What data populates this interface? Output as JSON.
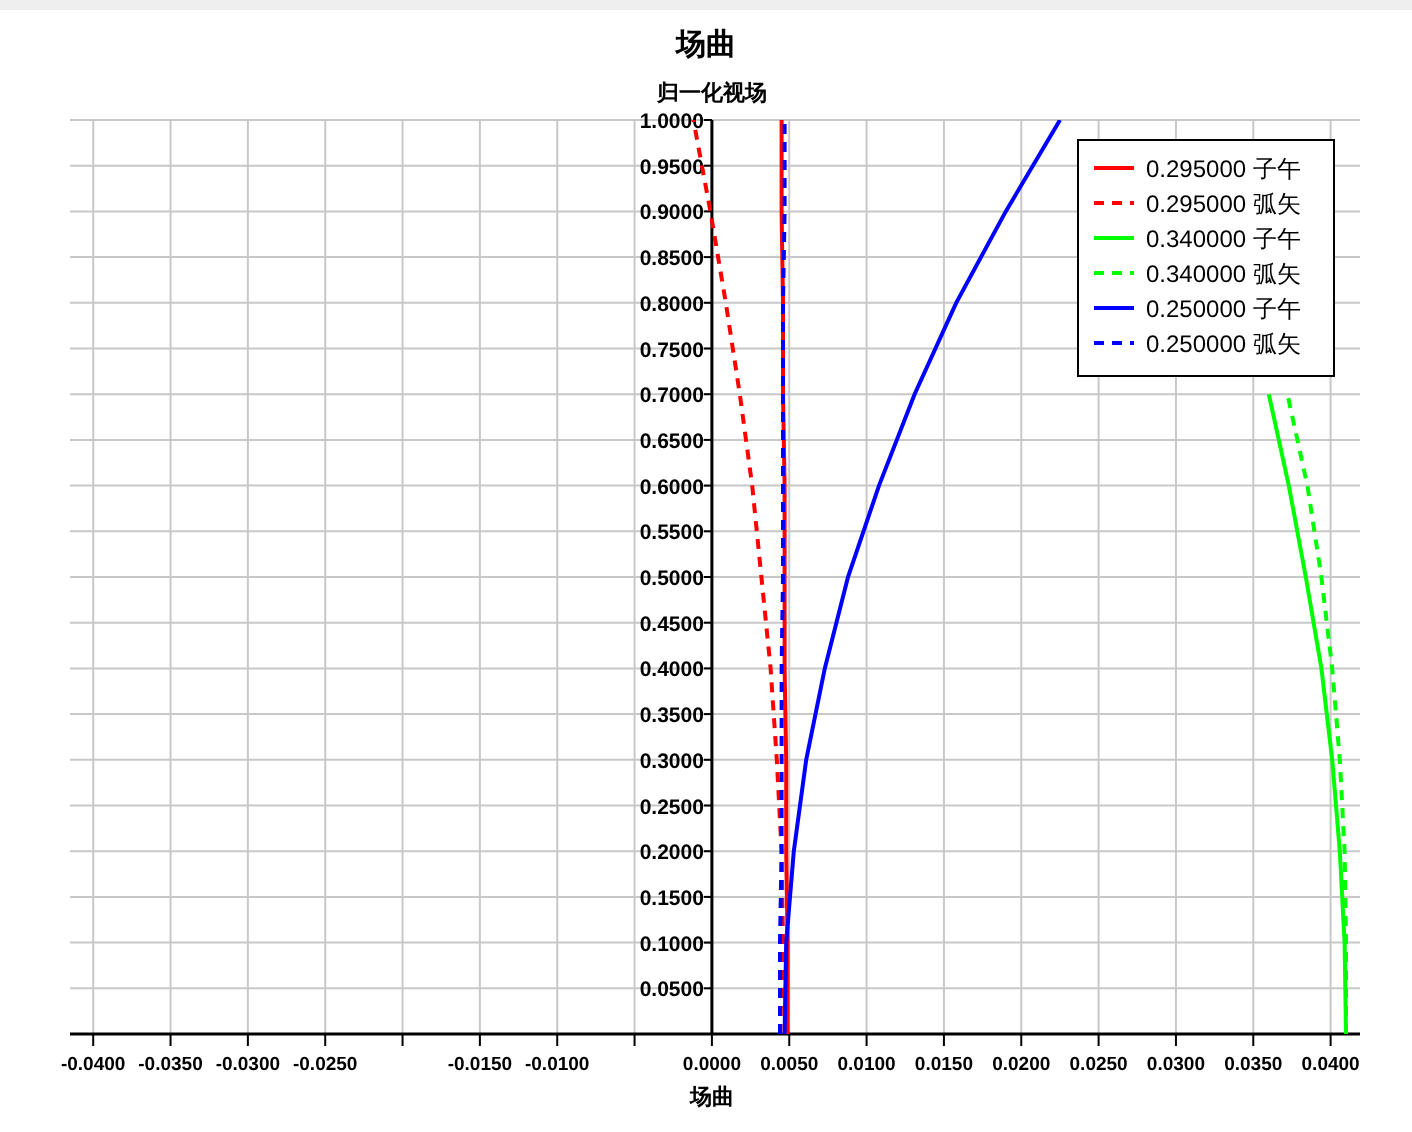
{
  "chart_data": {
    "type": "line",
    "title": "场曲",
    "ylabel": "归一化视场",
    "xlabel": "场曲",
    "orientation": "horizontal",
    "x": [
      0,
      0.1,
      0.2,
      0.3,
      0.4,
      0.5,
      0.6,
      0.7,
      0.8,
      0.9,
      1
    ],
    "series": [
      {
        "name": "0.295000 子午",
        "color": "#ff0000",
        "line_style": "solid",
        "values": [
          0.0049,
          0.0049,
          0.0048,
          0.0048,
          0.0047,
          0.0047,
          0.0047,
          0.0046,
          0.0046,
          0.0045,
          0.0045
        ]
      },
      {
        "name": "0.295000 弧矢",
        "color": "#ff0000",
        "line_style": "dashed",
        "values": [
          0.0047,
          0.0046,
          0.0045,
          0.0042,
          0.0038,
          0.0032,
          0.0026,
          0.0018,
          0.0009,
          -0.0001,
          -0.0012
        ]
      },
      {
        "name": "0.340000 子午",
        "color": "#00ff00",
        "line_style": "solid",
        "values": [
          0.041,
          0.0409,
          0.0406,
          0.0401,
          0.0394,
          0.0384,
          0.0373,
          0.036,
          null,
          null,
          null
        ]
      },
      {
        "name": "0.340000 弧矢",
        "color": "#00ff00",
        "line_style": "dashed",
        "values": [
          0.041,
          0.041,
          0.0409,
          0.0406,
          0.0401,
          0.0394,
          0.0385,
          0.0372,
          null,
          null,
          null
        ]
      },
      {
        "name": "0.250000 子午",
        "color": "#0000ff",
        "line_style": "solid",
        "values": [
          0.0047,
          0.0048,
          0.0053,
          0.0061,
          0.0073,
          0.0088,
          0.0108,
          0.0131,
          0.0158,
          0.019,
          0.0225
        ]
      },
      {
        "name": "0.250000 弧矢",
        "color": "#0000ff",
        "line_style": "dashed",
        "values": [
          0.0044,
          0.0044,
          0.0045,
          0.0045,
          0.0045,
          0.0046,
          0.0046,
          0.0046,
          0.0046,
          0.0047,
          0.0047
        ]
      }
    ],
    "grid": true,
    "legend": true,
    "xlim": [
      -0.0415,
      0.0419
    ],
    "ylim": [
      0,
      1
    ],
    "xticks": [
      {
        "value": -0.04,
        "label": "-0.0400"
      },
      {
        "value": -0.035,
        "label": "-0.0350"
      },
      {
        "value": -0.03,
        "label": "-0.0300"
      },
      {
        "value": -0.025,
        "label": "-0.0250"
      },
      {
        "value": -0.015,
        "label": "-0.0150"
      },
      {
        "value": -0.01,
        "label": "-0.0100"
      },
      {
        "value": 0,
        "label": "0.0000"
      },
      {
        "value": 0.005,
        "label": "0.0050"
      },
      {
        "value": 0.01,
        "label": "0.0100"
      },
      {
        "value": 0.015,
        "label": "0.0150"
      },
      {
        "value": 0.02,
        "label": "0.0200"
      },
      {
        "value": 0.025,
        "label": "0.0250"
      },
      {
        "value": 0.03,
        "label": "0.0300"
      },
      {
        "value": 0.035,
        "label": "0.0350"
      },
      {
        "value": 0.04,
        "label": "0.0400"
      }
    ],
    "yticks": [
      {
        "value": 0.05,
        "label": "0.0500"
      },
      {
        "value": 0.1,
        "label": "0.1000"
      },
      {
        "value": 0.15,
        "label": "0.1500"
      },
      {
        "value": 0.2,
        "label": "0.2000"
      },
      {
        "value": 0.25,
        "label": "0.2500"
      },
      {
        "value": 0.3,
        "label": "0.3000"
      },
      {
        "value": 0.35,
        "label": "0.3500"
      },
      {
        "value": 0.4,
        "label": "0.4000"
      },
      {
        "value": 0.45,
        "label": "0.4500"
      },
      {
        "value": 0.5,
        "label": "0.5000"
      },
      {
        "value": 0.55,
        "label": "0.5500"
      },
      {
        "value": 0.6,
        "label": "0.6000"
      },
      {
        "value": 0.65,
        "label": "0.6500"
      },
      {
        "value": 0.7,
        "label": "0.7000"
      },
      {
        "value": 0.75,
        "label": "0.7500"
      },
      {
        "value": 0.8,
        "label": "0.8000"
      },
      {
        "value": 0.85,
        "label": "0.8500"
      },
      {
        "value": 0.9,
        "label": "0.9000"
      },
      {
        "value": 0.95,
        "label": "0.9500"
      },
      {
        "value": 1,
        "label": "1.0000"
      }
    ]
  }
}
